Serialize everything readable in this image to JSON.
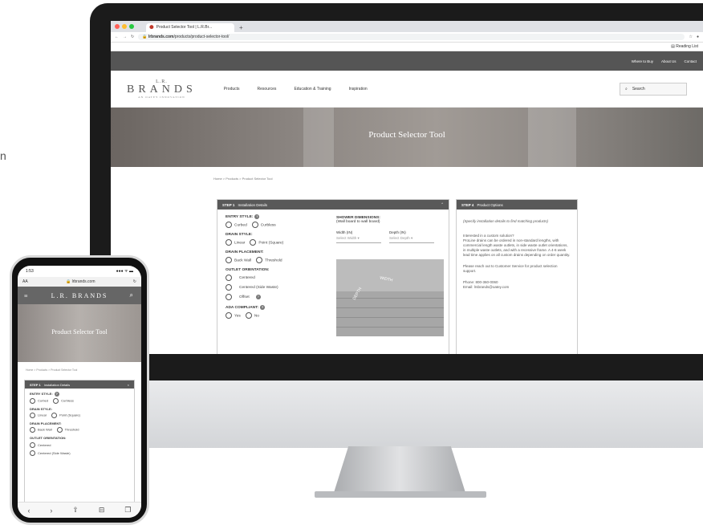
{
  "edge_letter": "n",
  "browser": {
    "tab_title": "Product Selector Tool | L.R.Br...",
    "new_tab": "+",
    "url_domain": "lrbrands.com",
    "url_path": "/products/product-selector-tool/",
    "reading_list": "Reading List"
  },
  "site": {
    "utility_links": [
      "Where to Buy",
      "About Us",
      "Contact"
    ],
    "logo": {
      "lr": "L.R.",
      "brands": "BRANDS",
      "tagline": "AN OATEY INNOVATION"
    },
    "nav_links": [
      "Products",
      "Resources",
      "Education & Training",
      "Inspiration"
    ],
    "search_label": "Search",
    "hero_title": "Product Selector Tool",
    "breadcrumb": "Home > Products > Product Selector Tool"
  },
  "step1": {
    "step": "STEP 1",
    "title": "Installation Details",
    "entry_style": "ENTRY STYLE:",
    "entry_options": [
      "Curbed",
      "Curbless"
    ],
    "drain_style": "DRAIN STYLE:",
    "drain_options": [
      "Linear",
      "Point (Square)"
    ],
    "drain_placement": "DRAIN PLACEMENT:",
    "placement_options": [
      "Back Wall",
      "Threshold"
    ],
    "outlet": "OUTLET ORIENTATION:",
    "outlet_options": [
      "Centered",
      "Centered (Side Waste)",
      "Offset"
    ],
    "ada": "ADA COMPLIANT:",
    "ada_options": [
      "Yes",
      "No"
    ],
    "dims_title": "SHOWER DIMENSIONS:",
    "dims_sub": "(Wall board to wall board)",
    "width_label": "Width (IN)",
    "depth_label": "Depth (IN)",
    "width_placeholder": "Select Width",
    "depth_placeholder": "Select Depth",
    "img_width": "WIDTH",
    "img_depth": "DEPTH"
  },
  "step4": {
    "step": "STEP 4",
    "title": "Product Options",
    "hint": "(Specify installation details to find matching products)",
    "custom_head": "Interested in a custom solution?",
    "custom_body": "ProLine drains can be ordered in non-standard lengths, with commercial length waste outlets, in side waste outlet orientations, in multiple waste outlets, and with a recessive frame. A 4-6 week lead time applies on all custom drains depending on order quantity.",
    "reach_out": "Please reach out to Customer Service for product selection support.",
    "phone": "Phone:  800-360-0060",
    "email": "Email:  lrsbrands@oatey.com"
  },
  "phone": {
    "time": "1:53",
    "signal": "●●● ᯤ ▬",
    "aa": "AA",
    "url": "lrbrands.com",
    "logo": "L.R. BRANDS",
    "hero_title": "Product Selector Tool",
    "breadcrumb": "Home > Products > Product Selector Tool",
    "step": "STEP 1",
    "title": "Installation Details"
  }
}
